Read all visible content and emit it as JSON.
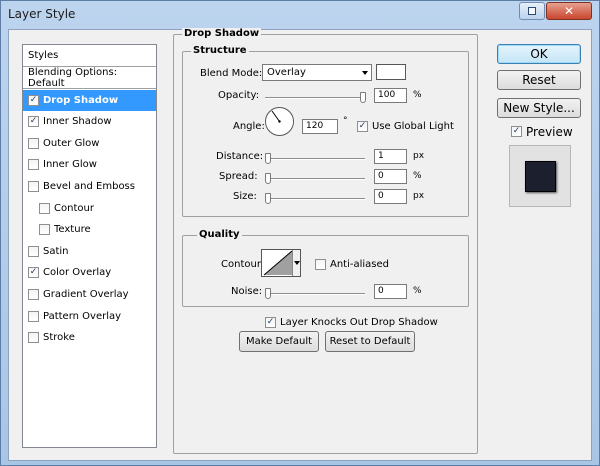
{
  "window": {
    "title": "Layer Style"
  },
  "styles_list": {
    "header": "Styles",
    "items": [
      {
        "label": "Blending Options: Default",
        "checkbox": false,
        "checked": false,
        "selected": false,
        "sub": false
      },
      {
        "label": "Drop Shadow",
        "checkbox": true,
        "checked": true,
        "selected": true,
        "sub": false
      },
      {
        "label": "Inner Shadow",
        "checkbox": true,
        "checked": true,
        "selected": false,
        "sub": false
      },
      {
        "label": "Outer Glow",
        "checkbox": true,
        "checked": false,
        "selected": false,
        "sub": false
      },
      {
        "label": "Inner Glow",
        "checkbox": true,
        "checked": false,
        "selected": false,
        "sub": false
      },
      {
        "label": "Bevel and Emboss",
        "checkbox": true,
        "checked": false,
        "selected": false,
        "sub": false
      },
      {
        "label": "Contour",
        "checkbox": true,
        "checked": false,
        "selected": false,
        "sub": true
      },
      {
        "label": "Texture",
        "checkbox": true,
        "checked": false,
        "selected": false,
        "sub": true
      },
      {
        "label": "Satin",
        "checkbox": true,
        "checked": false,
        "selected": false,
        "sub": false
      },
      {
        "label": "Color Overlay",
        "checkbox": true,
        "checked": true,
        "selected": false,
        "sub": false
      },
      {
        "label": "Gradient Overlay",
        "checkbox": true,
        "checked": false,
        "selected": false,
        "sub": false
      },
      {
        "label": "Pattern Overlay",
        "checkbox": true,
        "checked": false,
        "selected": false,
        "sub": false
      },
      {
        "label": "Stroke",
        "checkbox": true,
        "checked": false,
        "selected": false,
        "sub": false
      }
    ]
  },
  "drop_shadow": {
    "title": "Drop Shadow",
    "structure": {
      "title": "Structure",
      "blend_mode_label": "Blend Mode:",
      "blend_mode_value": "Overlay",
      "shadow_color": "#ffffff",
      "opacity_label": "Opacity:",
      "opacity_value": "100",
      "opacity_unit": "%",
      "angle_label": "Angle:",
      "angle_value": "120",
      "angle_unit": "°",
      "use_global_light_label": "Use Global Light",
      "use_global_light_checked": true,
      "distance_label": "Distance:",
      "distance_value": "1",
      "distance_unit": "px",
      "spread_label": "Spread:",
      "spread_value": "0",
      "spread_unit": "%",
      "size_label": "Size:",
      "size_value": "0",
      "size_unit": "px"
    },
    "quality": {
      "title": "Quality",
      "contour_label": "Contour:",
      "anti_aliased_label": "Anti-aliased",
      "anti_aliased_checked": false,
      "noise_label": "Noise:",
      "noise_value": "0",
      "noise_unit": "%"
    },
    "knockout_label": "Layer Knocks Out Drop Shadow",
    "knockout_checked": true,
    "make_default_label": "Make Default",
    "reset_default_label": "Reset to Default"
  },
  "actions": {
    "ok_label": "OK",
    "reset_label": "Reset",
    "new_style_label": "New Style...",
    "preview_label": "Preview",
    "preview_checked": true,
    "preview_color": "#1b1f2e"
  }
}
